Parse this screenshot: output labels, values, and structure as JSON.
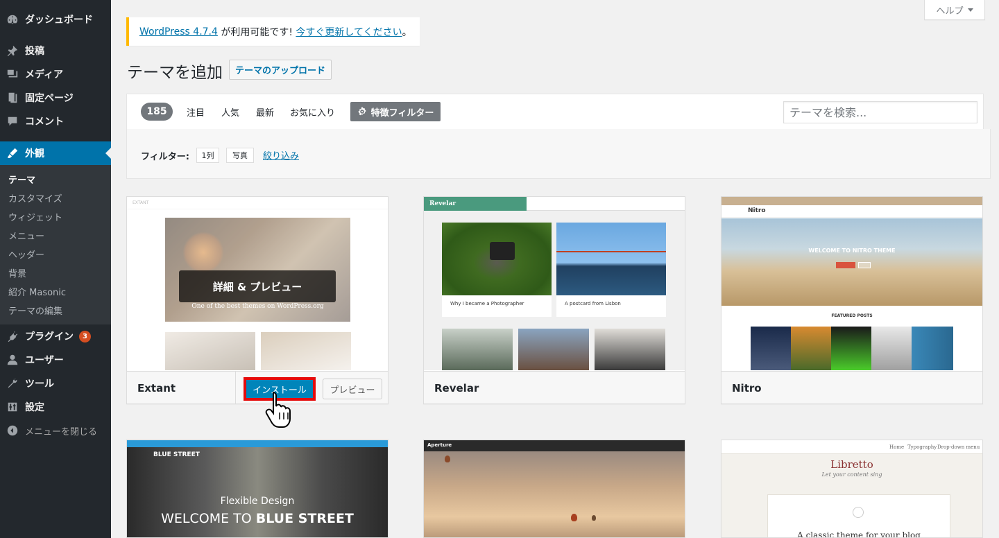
{
  "sidebar": {
    "dashboard": "ダッシュボード",
    "posts": "投稿",
    "media": "メディア",
    "pages": "固定ページ",
    "comments": "コメント",
    "appearance": "外観",
    "submenu": [
      "テーマ",
      "カスタマイズ",
      "ウィジェット",
      "メニュー",
      "ヘッダー",
      "背景",
      "紹介 Masonic",
      "テーマの編集"
    ],
    "plugins": "プラグイン",
    "plugins_badge": "3",
    "users": "ユーザー",
    "tools": "ツール",
    "settings": "設定",
    "collapse": "メニューを閉じる"
  },
  "help": {
    "label": "ヘルプ"
  },
  "notice": {
    "version_link": "WordPress 4.7.4",
    "middle_text": " が利用可能です! ",
    "update_link": "今すぐ更新してください",
    "end": "。"
  },
  "page": {
    "title": "テーマを追加",
    "upload_button": "テーマのアップロード"
  },
  "filter_bar": {
    "count": "185",
    "links": [
      "注目",
      "人気",
      "最新",
      "お気に入り"
    ],
    "feature_filter": "特徴フィルター",
    "search_placeholder": "テーマを検索..."
  },
  "filter_drawer": {
    "label": "フィルター:",
    "tags": [
      "1列",
      "写真"
    ],
    "apply": "絞り込み"
  },
  "themes": [
    {
      "name": "Extant",
      "overlay": "詳細 & プレビュー",
      "install": "インストール",
      "preview": "プレビュー",
      "shot_caption": "One of the best themes on WordPress.org",
      "shot_brand": "EXTANT"
    },
    {
      "name": "Revelar",
      "shot_brand": "Revelar",
      "post1": "Why I became a Photographer",
      "post2": "A postcard from Lisbon"
    },
    {
      "name": "Nitro",
      "shot_brand": "Nitro",
      "hero": "WELCOME TO NITRO THEME",
      "featured": "FEATURED POSTS"
    },
    {
      "name": "Blue Street",
      "shot_brand": "BLUE STREET",
      "line1": "Flexible Design",
      "line2a": "WELCOME TO ",
      "line2b": "BLUE STREET"
    },
    {
      "name": "Aperture",
      "shot_brand": "Aperture"
    },
    {
      "name": "Libretto",
      "shot_brand": "Libretto",
      "tagline": "Let your content sing",
      "nav": [
        "Home",
        "Typography",
        "Drop-down menu"
      ],
      "post_title": "A classic theme for your blog"
    }
  ],
  "colors": {
    "sidebar_bg": "#23282d",
    "accent": "#0073aa",
    "notice_border": "#ffb900",
    "install_highlight": "#e50b0b",
    "badge": "#d54e21"
  }
}
